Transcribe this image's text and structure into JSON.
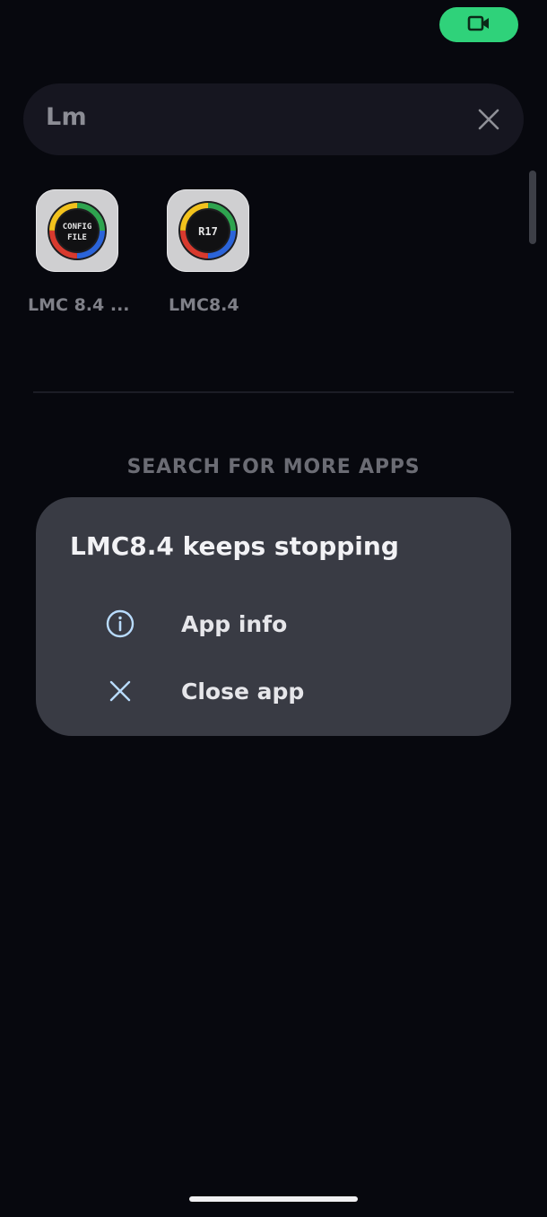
{
  "status": {
    "recording_icon": "video-camera-icon",
    "pill_color": "#2fd27a"
  },
  "search": {
    "query": "Lm",
    "clear_icon": "close-icon"
  },
  "results": [
    {
      "label": "LMC 8.4 ...",
      "icon_text_line1": "CONFIG",
      "icon_text_line2": "FILE"
    },
    {
      "label": "LMC8.4",
      "icon_text_line1": "R17",
      "icon_text_line2": ""
    }
  ],
  "more_apps_label": "SEARCH FOR MORE APPS",
  "dialog": {
    "title": "LMC8.4 keeps stopping",
    "options": [
      {
        "label": "App info",
        "icon": "info-icon"
      },
      {
        "label": "Close app",
        "icon": "close-icon"
      }
    ],
    "accent_color": "#b9dcff"
  }
}
